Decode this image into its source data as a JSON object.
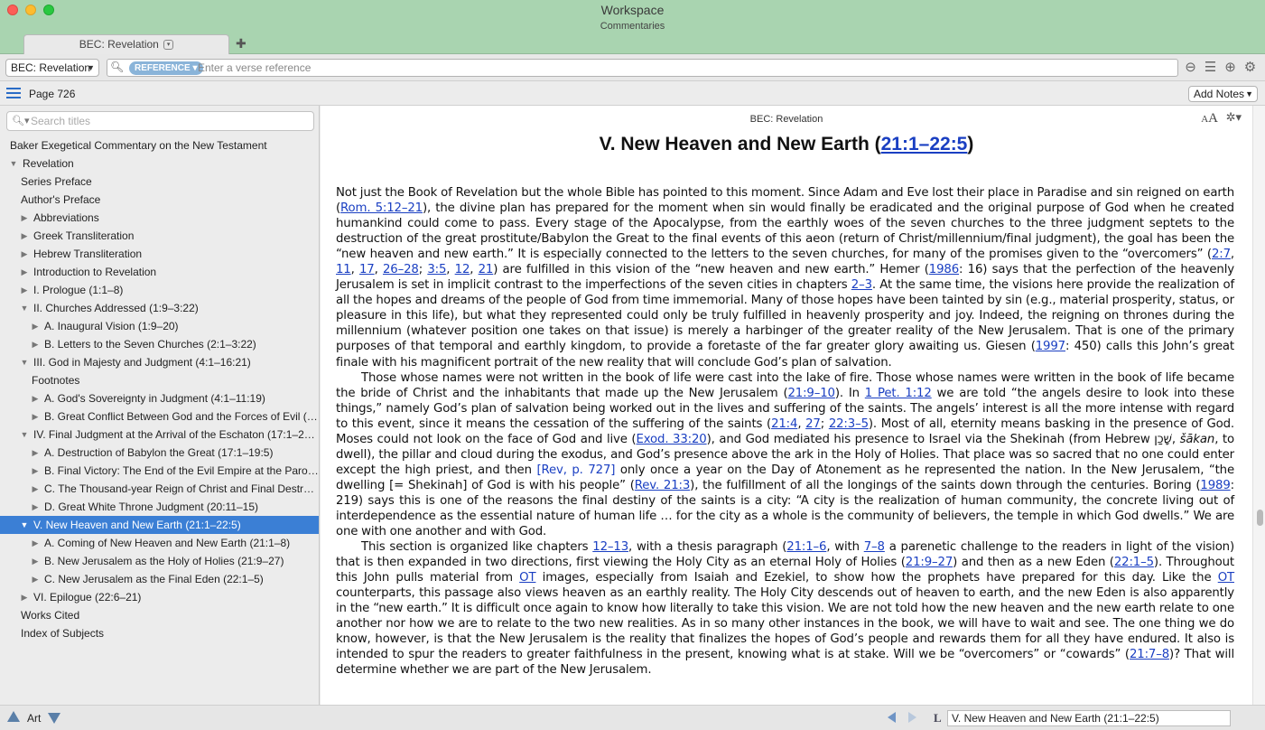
{
  "window": {
    "title": "Workspace",
    "subtitle": "Commentaries"
  },
  "tabs": [
    {
      "label": "BEC: Revelation",
      "menu": "▾"
    }
  ],
  "toolbar": {
    "resource": "BEC: Revelation",
    "search_type": "REFERENCE",
    "search_placeholder": "Enter a verse reference"
  },
  "pagebar": {
    "page": "Page 726",
    "add_notes": "Add Notes"
  },
  "sidebar": {
    "search_placeholder": "Search titles",
    "items": [
      {
        "label": "Baker Exegetical Commentary on the New Testament",
        "toggle": ""
      },
      {
        "label": "Revelation",
        "toggle": "▼"
      },
      {
        "label": "Series Preface",
        "toggle": ""
      },
      {
        "label": "Author's Preface",
        "toggle": ""
      },
      {
        "label": "Abbreviations",
        "toggle": "▶"
      },
      {
        "label": "Greek Transliteration",
        "toggle": "▶"
      },
      {
        "label": "Hebrew Transliteration",
        "toggle": "▶"
      },
      {
        "label": "Introduction to Revelation",
        "toggle": "▶"
      },
      {
        "label": "I. Prologue (1:1–8)",
        "toggle": "▶"
      },
      {
        "label": "II. Churches Addressed (1:9–3:22)",
        "toggle": "▼"
      },
      {
        "label": "A. Inaugural Vision (1:9–20)",
        "toggle": "▶"
      },
      {
        "label": "B. Letters to the Seven Churches (2:1–3:22)",
        "toggle": "▶"
      },
      {
        "label": "III. God in Majesty and Judgment (4:1–16:21)",
        "toggle": "▼"
      },
      {
        "label": "Footnotes",
        "toggle": ""
      },
      {
        "label": "A. God's Sovereignty in Judgment (4:1–11:19)",
        "toggle": "▶"
      },
      {
        "label": "B. Great Conflict Between God and the Forces of Evil (…",
        "toggle": "▶"
      },
      {
        "label": "IV. Final Judgment at the Arrival of the Eschaton (17:1–2…",
        "toggle": "▼"
      },
      {
        "label": "A. Destruction of Babylon the Great (17:1–19:5)",
        "toggle": "▶"
      },
      {
        "label": "B. Final Victory: The End of the Evil Empire at the Paro…",
        "toggle": "▶"
      },
      {
        "label": "C. The Thousand-year Reign of Christ and Final Destr…",
        "toggle": "▶"
      },
      {
        "label": "D. Great White Throne Judgment (20:11–15)",
        "toggle": "▶"
      },
      {
        "label": "V. New Heaven and New Earth (21:1–22:5)",
        "toggle": "▼"
      },
      {
        "label": "A. Coming of New Heaven and New Earth (21:1–8)",
        "toggle": "▶"
      },
      {
        "label": "B. New Jerusalem as the Holy of Holies (21:9–27)",
        "toggle": "▶"
      },
      {
        "label": "C. New Jerusalem as the Final Eden (22:1–5)",
        "toggle": "▶"
      },
      {
        "label": "VI. Epilogue (22:6–21)",
        "toggle": "▶"
      },
      {
        "label": "Works Cited",
        "toggle": ""
      },
      {
        "label": "Index of Subjects",
        "toggle": ""
      }
    ]
  },
  "content": {
    "resource_header": "BEC: Revelation",
    "font_small": "A",
    "font_big": "A",
    "title_text": "V. New Heaven and New Earth (",
    "title_ref": "21:1–22:5",
    "title_close": ")"
  },
  "statusbar": {
    "art_label": "Art",
    "location": "V. New Heaven and New Earth (21:1–22:5)"
  },
  "colors": {
    "titlebar": "#a9d4b0",
    "selection": "#3b7fd5",
    "link": "#1a3fc2"
  }
}
